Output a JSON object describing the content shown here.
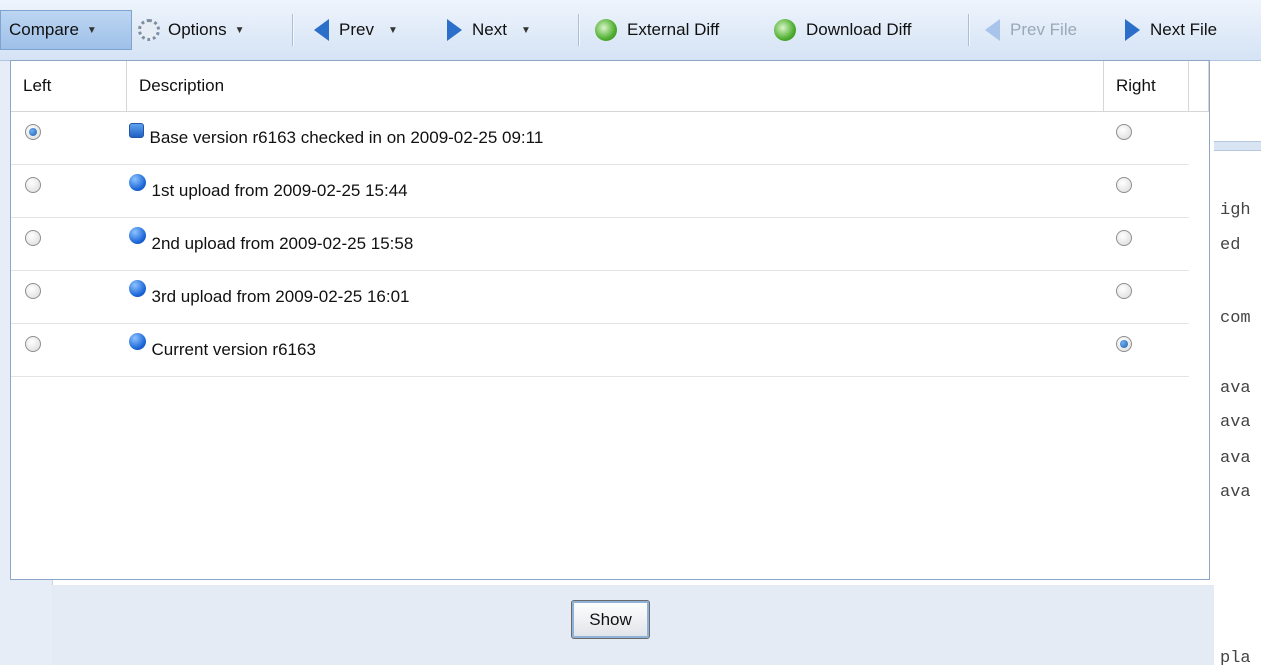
{
  "toolbar": {
    "compare_label": "Compare",
    "options_label": "Options",
    "prev_label": "Prev",
    "next_label": "Next",
    "external_diff_label": "External Diff",
    "download_diff_label": "Download Diff",
    "prev_file_label": "Prev File",
    "next_file_label": "Next File"
  },
  "popup": {
    "headers": {
      "left": "Left",
      "description": "Description",
      "right": "Right"
    },
    "rows": [
      {
        "description": "Base version r6163 checked in on 2009-02-25 09:11",
        "icon": "square-blue-icon",
        "left_selected": true,
        "right_selected": false
      },
      {
        "description": "1st upload from 2009-02-25 15:44",
        "icon": "blue-ball-icon",
        "left_selected": false,
        "right_selected": false
      },
      {
        "description": "2nd upload from 2009-02-25 15:58",
        "icon": "blue-ball-icon",
        "left_selected": false,
        "right_selected": false
      },
      {
        "description": "3rd upload from 2009-02-25 16:01",
        "icon": "blue-ball-icon",
        "left_selected": false,
        "right_selected": false
      },
      {
        "description": "Current version r6163",
        "icon": "blue-ball-icon",
        "left_selected": false,
        "right_selected": true
      }
    ]
  },
  "show_button_label": "Show",
  "background": {
    "code_fragments": [
      "igh",
      "ed",
      "com",
      "ava",
      "ava",
      "ava",
      "ava",
      "pla"
    ]
  },
  "colors": {
    "toolbar_bg": "#d5e3f5",
    "accent": "#2c6fcb",
    "border": "#8ca6c8"
  }
}
